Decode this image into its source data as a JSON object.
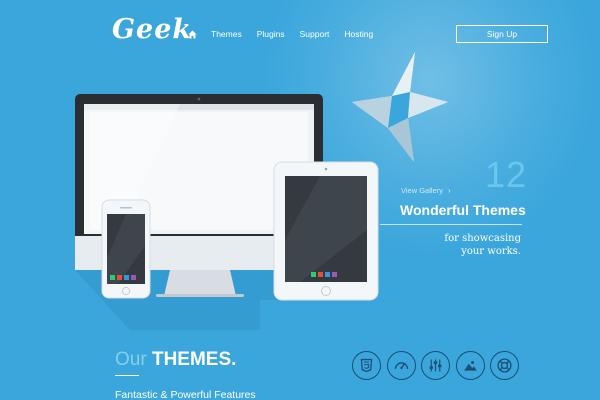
{
  "header": {
    "logo": "Geek",
    "nav": [
      "Themes",
      "Plugins",
      "Support",
      "Hosting"
    ],
    "signup_label": "Sign Up"
  },
  "hero": {
    "count": "12",
    "view_gallery": "View Gallery",
    "headline": "Wonderful Themes",
    "sub_line1": "for showcasing",
    "sub_line2": "your works."
  },
  "bottom": {
    "title_our": "Our",
    "title_themes": "THEMES.",
    "tagline": "Fantastic & Powerful Features",
    "feature_icons": [
      "html5-icon",
      "speedometer-icon",
      "sliders-icon",
      "image-icon",
      "lifebuoy-icon"
    ]
  },
  "colors": {
    "background": "#3aa6dc",
    "accent_light": "#6ac6ea",
    "icon_dark": "#1b4f76"
  }
}
